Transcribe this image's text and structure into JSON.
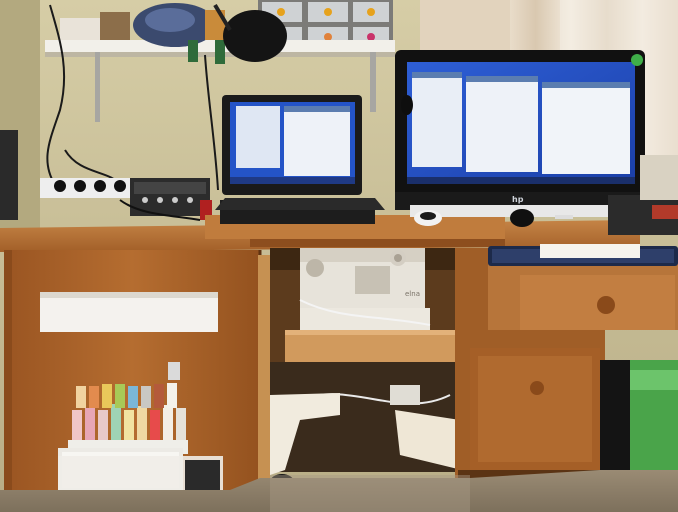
{
  "photo": {
    "subject": "sewing-cabinet-workspace",
    "monitor_brand": "hp",
    "sewing_machine_brand": "elna",
    "palette": {
      "wall": "#c7bd95",
      "cabinet_wood": "#a9622a",
      "cabinet_dark": "#7a4418",
      "carpet": "#8d7f6b",
      "curtain": "#e9dccb",
      "monitor_screen": "#1d47c0",
      "laptop_screen": "#2454c7"
    }
  }
}
